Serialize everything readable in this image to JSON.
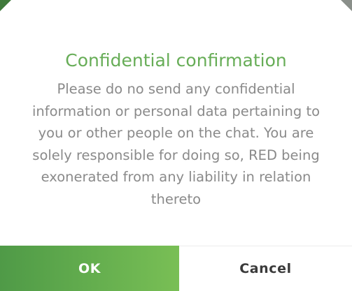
{
  "dialog": {
    "title": "Confidential confirmation",
    "message": "Please do no send any confidential information or personal data pertaining to you or other people on the chat. You are solely responsible for doing so, RED being exonerated from any liability in relation thereto",
    "ok_label": "OK",
    "cancel_label": "Cancel"
  },
  "colors": {
    "title": "#67ad57",
    "ok_button": "#63ad4e",
    "message": "#8a8a8a"
  }
}
